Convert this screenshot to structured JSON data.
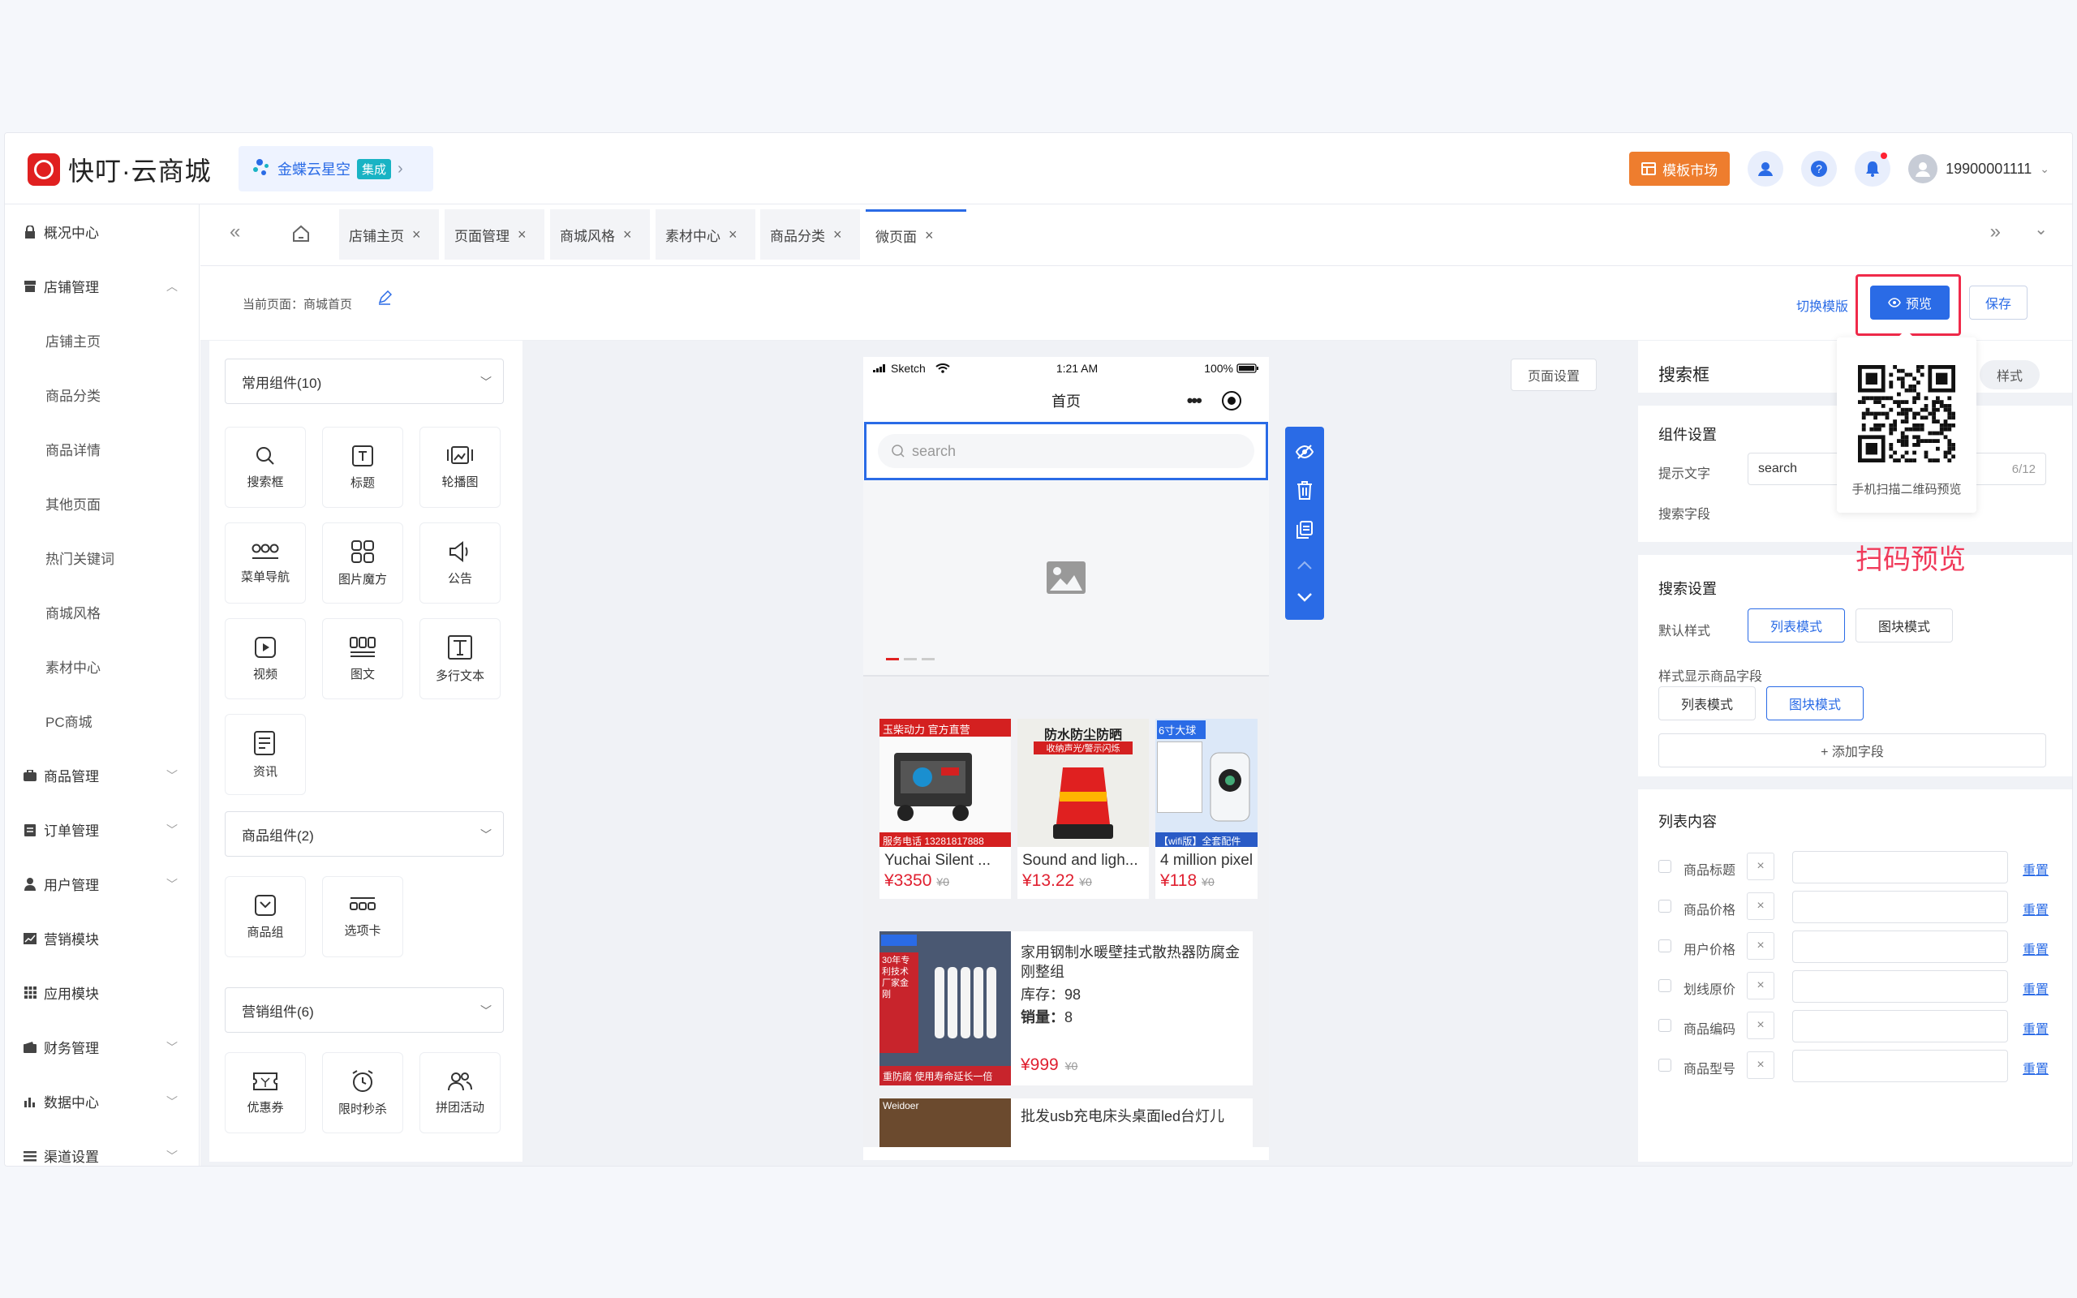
{
  "app": {
    "logo_text": "快叮·云商城",
    "kingdee_text": "金蝶云星空",
    "kingdee_badge": "集成",
    "market_label": "模板市场",
    "user_phone": "19900001111"
  },
  "sidebar": {
    "items": [
      {
        "label": "概况中心",
        "icon": "lock-icon"
      },
      {
        "label": "店铺管理",
        "icon": "store-icon",
        "expanded": true
      },
      {
        "label": "店铺主页",
        "sub": true
      },
      {
        "label": "商品分类",
        "sub": true
      },
      {
        "label": "商品详情",
        "sub": true
      },
      {
        "label": "其他页面",
        "sub": true
      },
      {
        "label": "热门关键词",
        "sub": true
      },
      {
        "label": "商城风格",
        "sub": true
      },
      {
        "label": "素材中心",
        "sub": true
      },
      {
        "label": "PC商城",
        "sub": true
      },
      {
        "label": "商品管理",
        "icon": "goods-icon"
      },
      {
        "label": "订单管理",
        "icon": "order-icon"
      },
      {
        "label": "用户管理",
        "icon": "user-icon"
      },
      {
        "label": "营销模块",
        "icon": "marketing-icon"
      },
      {
        "label": "应用模块",
        "icon": "apps-icon"
      },
      {
        "label": "财务管理",
        "icon": "wallet-icon"
      },
      {
        "label": "数据中心",
        "icon": "chart-icon"
      },
      {
        "label": "渠道设置",
        "icon": "list-icon"
      }
    ]
  },
  "tabs": [
    {
      "label": "店铺主页"
    },
    {
      "label": "页面管理"
    },
    {
      "label": "商城风格"
    },
    {
      "label": "素材中心"
    },
    {
      "label": "商品分类"
    },
    {
      "label": "微页面",
      "active": true
    }
  ],
  "pagebar": {
    "current_page": "当前页面：商城首页",
    "switch_template": "切换模版",
    "preview": "预览",
    "save": "保存"
  },
  "components": {
    "group1_label": "常用组件(10)",
    "group1": [
      "搜索框",
      "标题",
      "轮播图",
      "菜单导航",
      "图片魔方",
      "公告",
      "视频",
      "图文",
      "多行文本",
      "资讯"
    ],
    "group2_label": "商品组件(2)",
    "group2": [
      "商品组",
      "选项卡"
    ],
    "group3_label": "营销组件(6)",
    "group3": [
      "优惠券",
      "限时秒杀",
      "拼团活动"
    ]
  },
  "phone": {
    "carrier": "Sketch",
    "time": "1:21 AM",
    "battery": "100%",
    "title": "首页",
    "search_placeholder": "search",
    "grid_products": [
      {
        "name": "Yuchai Silent ...",
        "price": "¥3350",
        "old": "¥0",
        "img_text": "玉柴动力 官方直营",
        "img_sub": "服务电话 13281817888"
      },
      {
        "name": "Sound and ligh...",
        "price": "¥13.22",
        "old": "¥0",
        "img_text": "防水防尘防晒",
        "img_sub": "收纳声光/警示闪烁"
      },
      {
        "name": "4 million pixel",
        "price": "¥118",
        "old": "¥0",
        "img_text": "6寸大球",
        "img_sub": "【wifi版】全套配件"
      }
    ],
    "list_products": [
      {
        "name": "家用钢制水暖壁挂式散热器防腐金刚整组",
        "stock_label": "库存：",
        "stock": "98",
        "sales_label": "销量：",
        "sales": "8",
        "price": "¥999",
        "old": "¥0",
        "img_text": "30年专利技术 厂家金刚",
        "img_sub": "重防腐 使用寿命延长一倍"
      },
      {
        "name": "批发usb充电床头桌面led台灯儿",
        "img_text": "Weidoer"
      }
    ]
  },
  "page_settings": "页面设置",
  "right_panel": {
    "title": "搜索框",
    "style_toggle": "样式",
    "component_settings": "组件设置",
    "hint_label": "提示文字",
    "hint_value": "search",
    "hint_count": "6/12",
    "search_field_label": "搜索字段",
    "search_settings": "搜索设置",
    "default_style_label": "默认样式",
    "list_mode": "列表模式",
    "block_mode": "图块模式",
    "display_fields_label": "样式显示商品字段",
    "add_field": "+ 添加字段",
    "list_content": "列表内容",
    "rows": [
      {
        "label": "商品标题",
        "reset": "重置"
      },
      {
        "label": "商品价格",
        "reset": "重置"
      },
      {
        "label": "用户价格",
        "reset": "重置"
      },
      {
        "label": "划线原价",
        "reset": "重置"
      },
      {
        "label": "商品编码",
        "reset": "重置"
      },
      {
        "label": "商品型号",
        "reset": "重置"
      }
    ]
  },
  "qr": {
    "caption": "手机扫描二维码预览",
    "annotation": "扫码预览"
  },
  "colors": {
    "primary": "#2a6be6",
    "accent_red": "#e02030",
    "market_orange": "#ee7d2e",
    "highlight": "#f02a4a"
  }
}
